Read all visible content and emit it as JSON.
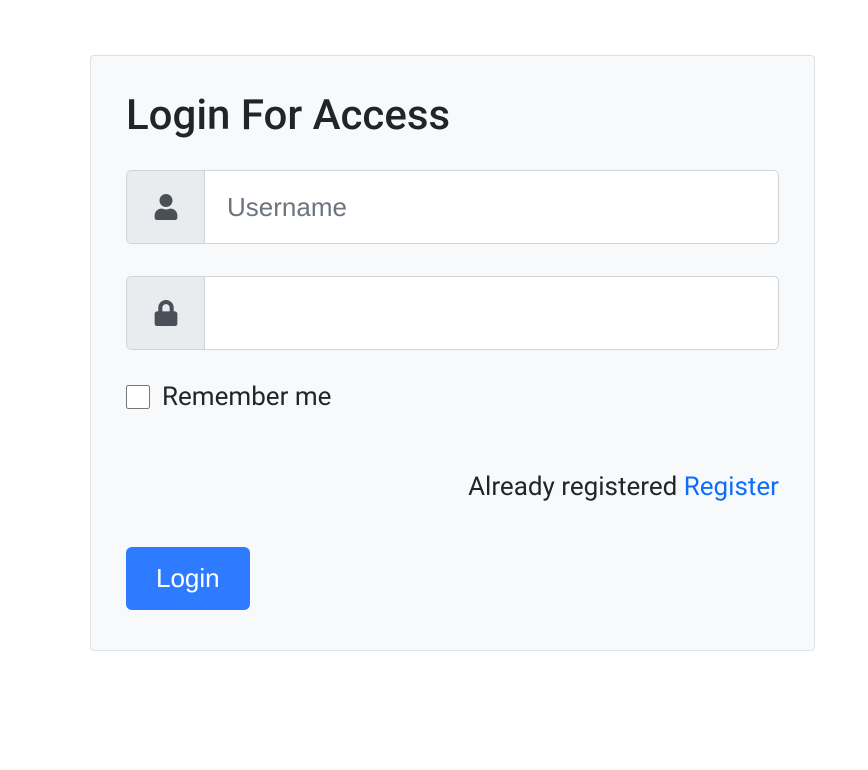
{
  "card": {
    "title": "Login For Access"
  },
  "username": {
    "placeholder": "Username",
    "value": ""
  },
  "password": {
    "placeholder": "",
    "value": ""
  },
  "remember": {
    "label": "Remember me"
  },
  "register": {
    "text": "Already registered ",
    "link_label": "Register"
  },
  "login_button": {
    "label": "Login"
  }
}
